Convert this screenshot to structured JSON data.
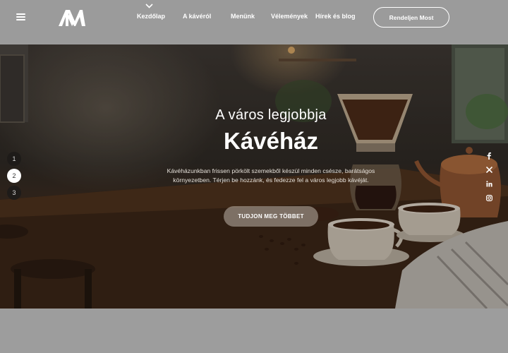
{
  "header": {
    "menu_icon": "hamburger-icon",
    "logo_icon": "brand-logo",
    "nav": [
      {
        "label": "Kezdőlap",
        "active": true
      },
      {
        "label": "A kávéról"
      },
      {
        "label": "Menünk"
      },
      {
        "label": "Vélemények"
      },
      {
        "label": "Hírek és blog"
      }
    ],
    "cta_label": "Rendeljen Most"
  },
  "hero": {
    "subtitle": "A város legjobbja",
    "title": "Kávéház",
    "description": "Kávéházunkban frissen pörkölt szemekből készül minden csésze, barátságos környezetben. Térjen be hozzánk, és fedezze fel a város legjobb kávéját.",
    "button_label": "TUDJON MEG TÖBBET"
  },
  "slides": [
    "1",
    "2",
    "3"
  ],
  "active_slide": "2",
  "social": [
    "facebook-icon",
    "x-icon",
    "linkedin-icon",
    "instagram-icon"
  ],
  "colors": {
    "header_bg": "#9b9b9b",
    "text": "#ffffff"
  }
}
